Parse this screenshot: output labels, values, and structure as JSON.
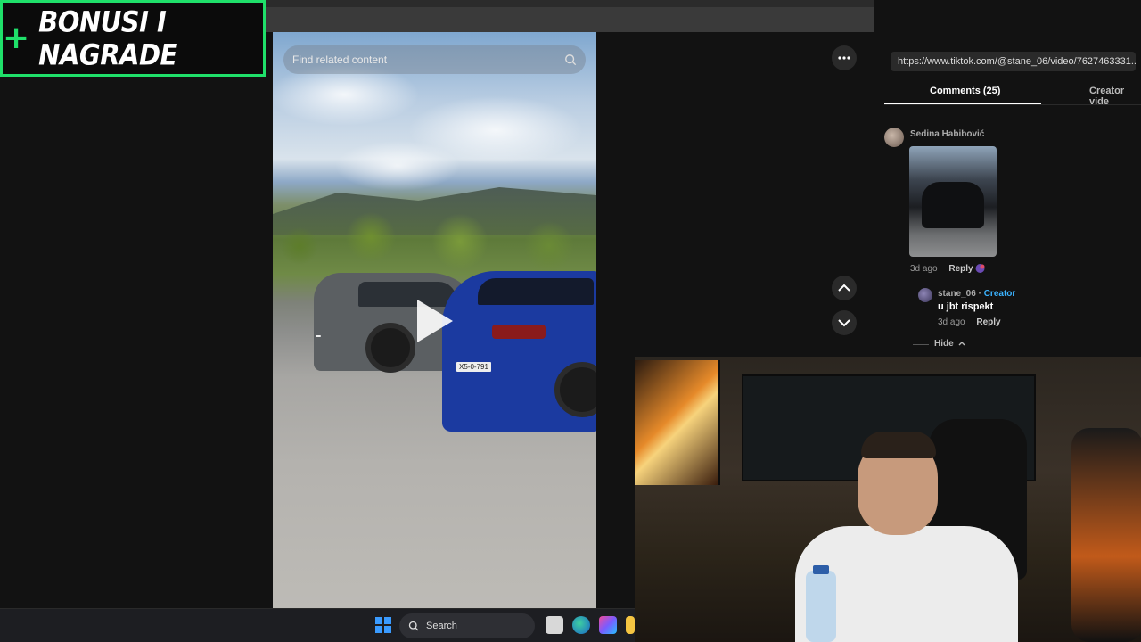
{
  "banner": {
    "plus": "+",
    "text": "BONUSI I NAGRADE"
  },
  "video": {
    "search_placeholder": "Find related content",
    "plate_grey": "",
    "plate_blue": "X5-0-791"
  },
  "panel": {
    "url": "https://www.tiktok.com/@stane_06/video/7627463331...",
    "tabs": [
      {
        "label": "Comments (25)",
        "active": true
      },
      {
        "label": "Creator vide",
        "active": false
      }
    ],
    "comments": [
      {
        "author": "Sedina Habibović",
        "time": "3d ago",
        "reply_label": "Reply",
        "replies": [
          {
            "author": "stane_06",
            "separator": " · ",
            "badge": "Creator",
            "text": "u jbt rispekt",
            "time": "3d ago",
            "reply_label": "Reply"
          }
        ]
      }
    ],
    "hide_label": "Hide"
  },
  "taskbar": {
    "search_label": "Search"
  },
  "colors": {
    "banner_accent": "#1fe06a",
    "creator_badge": "#3bb3ff",
    "windows_blue": "#3a9bff"
  }
}
